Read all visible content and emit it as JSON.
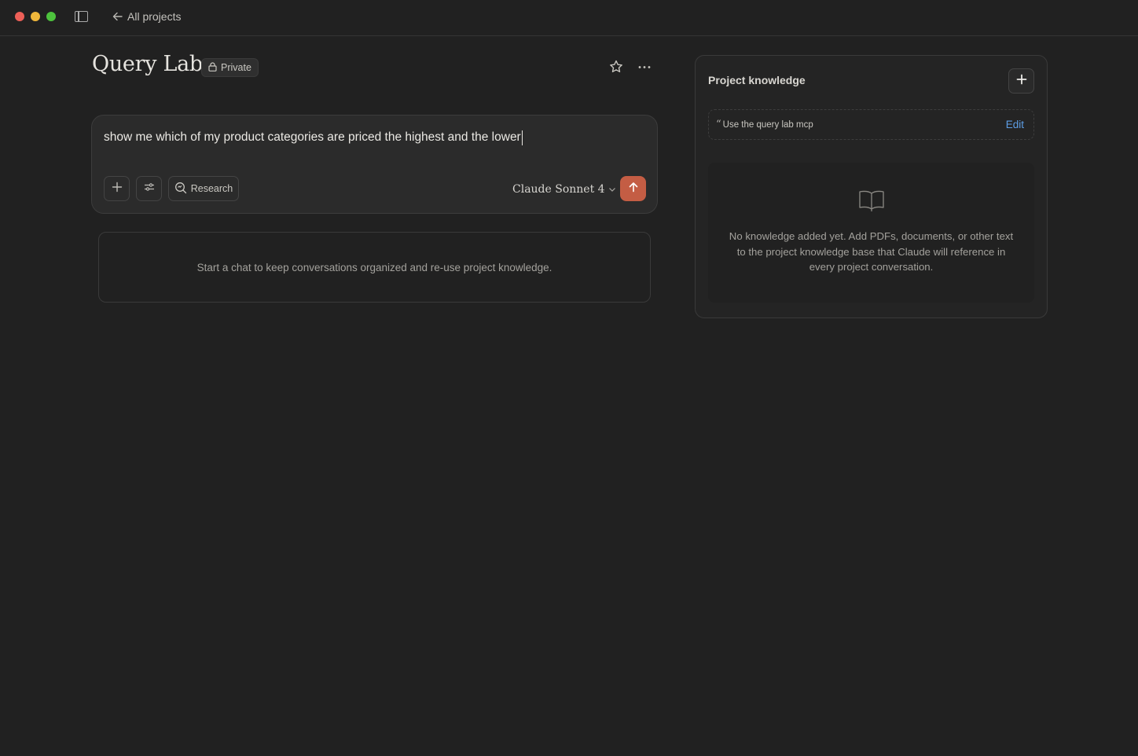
{
  "titlebar": {
    "back_label": "All projects"
  },
  "project": {
    "title": "Query Lab",
    "visibility_badge": "Private"
  },
  "composer": {
    "input_value": "show me which of my product categories are priced the highest and the lower",
    "research_label": "Research",
    "model_label": "Claude Sonnet 4",
    "send_color": "#c45d44"
  },
  "empty_state": {
    "message": "Start a chat to keep conversations organized and re-use project knowledge."
  },
  "knowledge": {
    "title": "Project knowledge",
    "instruction_text": "Use the query lab mcp",
    "edit_label": "Edit",
    "empty_message": "No knowledge added yet. Add PDFs, documents, or other text to the project knowledge base that Claude will reference in every project conversation."
  },
  "icons": {
    "traffic_lights": [
      "close",
      "minimize",
      "maximize"
    ],
    "sidebar_toggle": "sidebar-icon",
    "back": "arrow-left-icon",
    "badge": "lock-icon",
    "star": "star-icon",
    "more": "ellipsis-icon",
    "add": "plus-icon",
    "settings": "sliders-icon",
    "research": "search-icon",
    "model_dropdown": "chevron-down-icon",
    "send": "arrow-up-icon",
    "knowledge_empty": "book-open-icon"
  },
  "colors": {
    "background": "#212121",
    "accent": "#c45d44",
    "link": "#5d9ee6"
  }
}
